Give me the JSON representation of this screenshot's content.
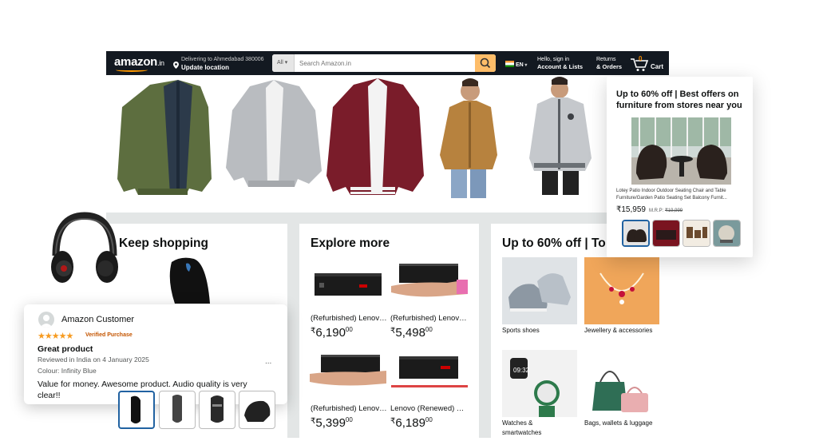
{
  "nav": {
    "logo": "amazon",
    "logo_tld": ".in",
    "deliver_line1": "Delivering to Ahmedabad 380006",
    "deliver_line2": "Update location",
    "search_category": "All",
    "search_placeholder": "Search Amazon.in",
    "language": "EN",
    "account_line1": "Hello, sign in",
    "account_line2": "Account & Lists",
    "orders_line1": "Returns",
    "orders_line2": "& Orders",
    "cart_count": "0",
    "cart_label": "Cart"
  },
  "keep_shopping": {
    "title": "Keep shopping"
  },
  "explore_more": {
    "title": "Explore more",
    "items": [
      {
        "title": "(Refurbished) Lenovo ThinkCentre",
        "symbol": "₹",
        "price": "6,190",
        "cents": "00"
      },
      {
        "title": "(Refurbished) Lenovo ThinkCentre",
        "symbol": "₹",
        "price": "5,498",
        "cents": "00"
      },
      {
        "title": "(Refurbished) Lenovo ThinkCentre",
        "symbol": "₹",
        "price": "5,399",
        "cents": "00"
      },
      {
        "title": "Lenovo (Renewed) ThinkCentre",
        "symbol": "₹",
        "price": "6,189",
        "cents": "00"
      }
    ]
  },
  "offers": {
    "title": "Up to 60% off | To",
    "categories": [
      "Sports shoes",
      "Jewellery & accessories",
      "Watches & smartwatches",
      "Bags, wallets & luggage"
    ]
  },
  "offer_card": {
    "title": "Up to 60% off | Best offers on furniture from stores near you",
    "description": "Lotey Patio Indoor Outdoor Seating Chair and Table Furniture/Garden Patio Seating Set Balcony Furnit...",
    "price": "₹15,959",
    "mrp_label": "M.R.P:",
    "mrp": "₹19,999"
  },
  "review": {
    "name": "Amazon Customer",
    "stars": "★★★★★",
    "rating": 5,
    "verified": "Verified Purchase",
    "title": "Great product",
    "meta": "Reviewed in India on 4 January 2025",
    "colour": "Colour: Infinity Blue",
    "more": "...",
    "body": "Value for money. Awesome product. Audio quality is very clear!!"
  },
  "colors": {
    "nav_bg": "#131921",
    "search_button": "#febd69",
    "accent_orange": "#ff9900",
    "star": "#f79b20",
    "verified": "#c45500",
    "selected_border": "#2162a1"
  }
}
